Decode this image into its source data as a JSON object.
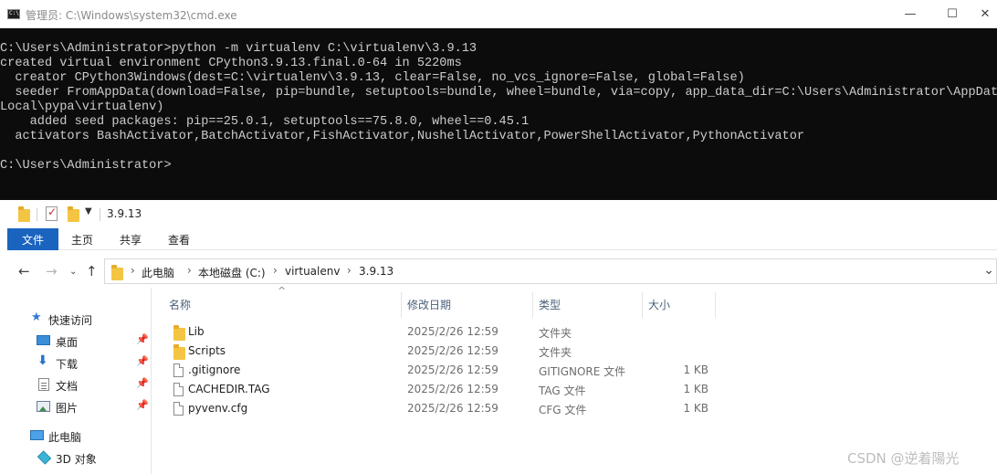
{
  "cmd": {
    "title": "管理员: C:\\Windows\\system32\\cmd.exe",
    "buttons": {
      "minimize": "—",
      "maximize": "☐",
      "close": "✕"
    },
    "lines": [
      "C:\\Users\\Administrator>python -m virtualenv C:\\virtualenv\\3.9.13",
      "created virtual environment CPython3.9.13.final.0-64 in 5220ms",
      "  creator CPython3Windows(dest=C:\\virtualenv\\3.9.13, clear=False, no_vcs_ignore=False, global=False)",
      "  seeder FromAppData(download=False, pip=bundle, setuptools=bundle, wheel=bundle, via=copy, app_data_dir=C:\\Users\\Administrator\\AppData\\",
      "Local\\pypa\\virtualenv)",
      "    added seed packages: pip==25.0.1, setuptools==75.8.0, wheel==0.45.1",
      "  activators BashActivator,BatchActivator,FishActivator,NushellActivator,PowerShellActivator,PythonActivator",
      "",
      "C:\\Users\\Administrator>"
    ]
  },
  "explorer": {
    "window_title": "3.9.13",
    "ribbon_tabs": [
      "文件",
      "主页",
      "共享",
      "查看"
    ],
    "breadcrumb": [
      "此电脑",
      "本地磁盘 (C:)",
      "virtualenv",
      "3.9.13"
    ],
    "nav": {
      "quick_access": "快速访问",
      "items": [
        {
          "label": "桌面",
          "icon": "desktop-icon"
        },
        {
          "label": "下载",
          "icon": "download-icon"
        },
        {
          "label": "文档",
          "icon": "document-icon"
        },
        {
          "label": "图片",
          "icon": "pictures-icon"
        }
      ],
      "this_pc": "此电脑",
      "objects_3d": "3D 对象"
    },
    "columns": {
      "name": "名称",
      "date": "修改日期",
      "type": "类型",
      "size": "大小"
    },
    "files": [
      {
        "name": "Lib",
        "date": "2025/2/26 12:59",
        "type": "文件夹",
        "size": "",
        "kind": "folder"
      },
      {
        "name": "Scripts",
        "date": "2025/2/26 12:59",
        "type": "文件夹",
        "size": "",
        "kind": "folder"
      },
      {
        "name": ".gitignore",
        "date": "2025/2/26 12:59",
        "type": "GITIGNORE 文件",
        "size": "1 KB",
        "kind": "file"
      },
      {
        "name": "CACHEDIR.TAG",
        "date": "2025/2/26 12:59",
        "type": "TAG 文件",
        "size": "1 KB",
        "kind": "file"
      },
      {
        "name": "pyvenv.cfg",
        "date": "2025/2/26 12:59",
        "type": "CFG 文件",
        "size": "1 KB",
        "kind": "file"
      }
    ]
  },
  "watermark": "CSDN @逆着陽光",
  "colors": {
    "console_bg": "#0c0c0c",
    "console_text": "#cccccc",
    "ribbon_file": "#1a64c0",
    "folder": "#f3c542"
  }
}
